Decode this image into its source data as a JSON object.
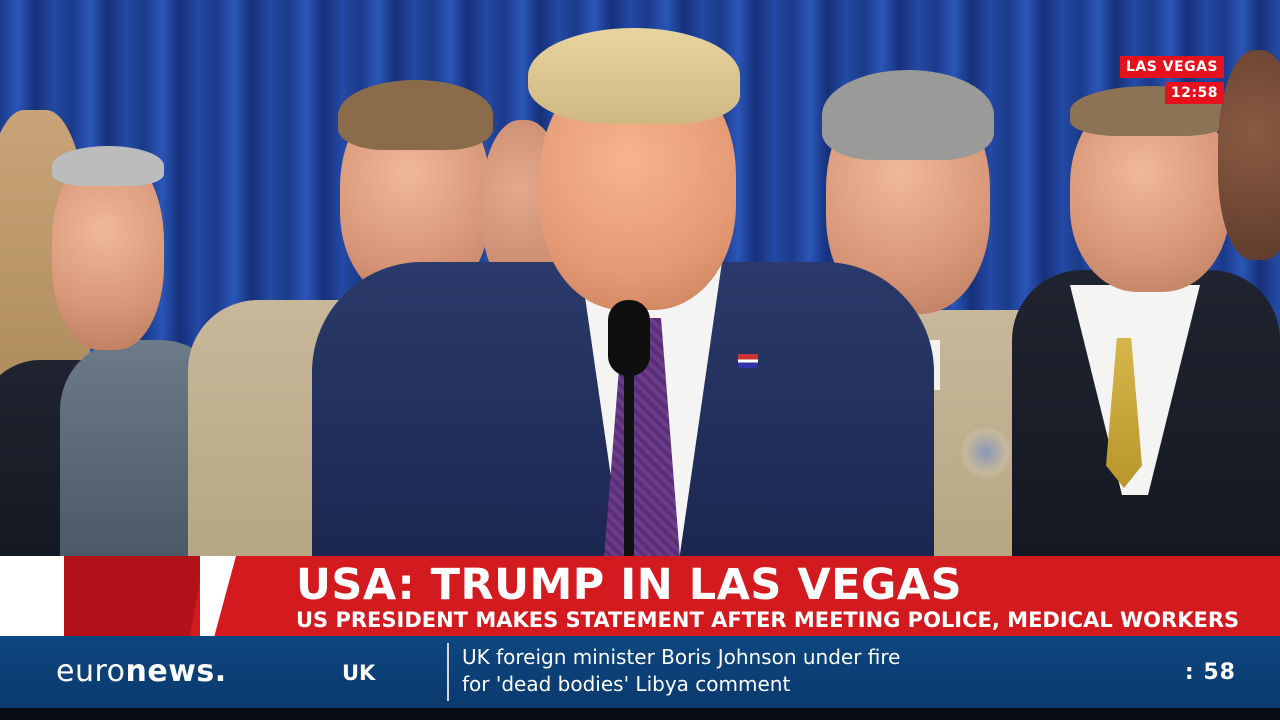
{
  "overlay": {
    "location": "LAS VEGAS",
    "time": "12:58"
  },
  "lower_third": {
    "headline": "USA: TRUMP IN LAS VEGAS",
    "subheadline": "US PRESIDENT MAKES STATEMENT AFTER MEETING POLICE, MEDICAL WORKERS"
  },
  "ticker": {
    "logo_part1": "euro",
    "logo_part2": "news",
    "logo_dot": ".",
    "region": "UK",
    "line1": "UK foreign minister Boris Johnson under fire",
    "line2": "for 'dead bodies' Libya comment",
    "countdown": ": 58"
  },
  "colors": {
    "accent_red": "#d21a1f",
    "ticker_blue": "#0d4680",
    "curtain_blue": "#2a55b8"
  }
}
